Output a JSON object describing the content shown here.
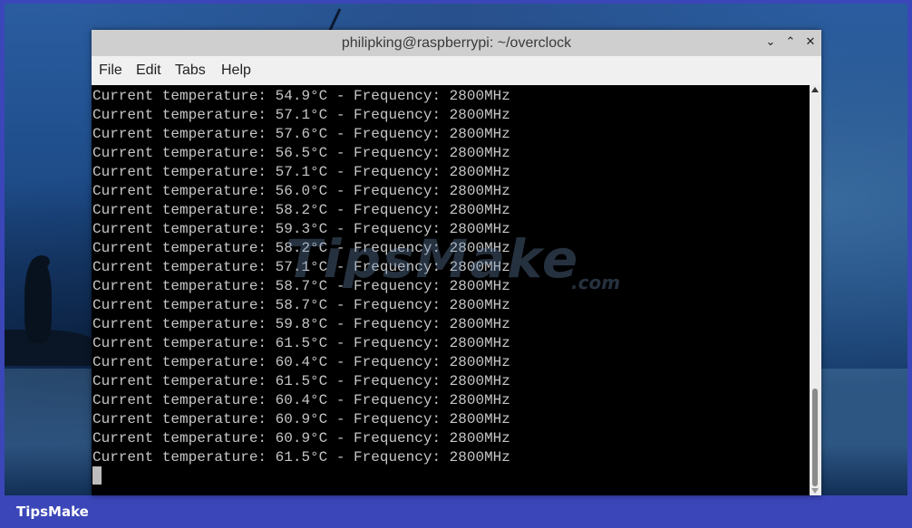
{
  "window": {
    "title": "philipking@raspberrypi: ~/overclock",
    "buttons": {
      "minimize": "⌄",
      "maximize": "⌃",
      "close": "✕"
    }
  },
  "menu": [
    "File",
    "Edit",
    "Tabs",
    "Help"
  ],
  "terminal": {
    "lines": [
      "Current temperature: 54.9°C - Frequency: 2800MHz",
      "Current temperature: 57.1°C - Frequency: 2800MHz",
      "Current temperature: 57.6°C - Frequency: 2800MHz",
      "Current temperature: 56.5°C - Frequency: 2800MHz",
      "Current temperature: 57.1°C - Frequency: 2800MHz",
      "Current temperature: 56.0°C - Frequency: 2800MHz",
      "Current temperature: 58.2°C - Frequency: 2800MHz",
      "Current temperature: 59.3°C - Frequency: 2800MHz",
      "Current temperature: 58.2°C - Frequency: 2800MHz",
      "Current temperature: 57.1°C - Frequency: 2800MHz",
      "Current temperature: 58.7°C - Frequency: 2800MHz",
      "Current temperature: 58.7°C - Frequency: 2800MHz",
      "Current temperature: 59.8°C - Frequency: 2800MHz",
      "Current temperature: 61.5°C - Frequency: 2800MHz",
      "Current temperature: 60.4°C - Frequency: 2800MHz",
      "Current temperature: 61.5°C - Frequency: 2800MHz",
      "Current temperature: 60.4°C - Frequency: 2800MHz",
      "Current temperature: 60.9°C - Frequency: 2800MHz",
      "Current temperature: 60.9°C - Frequency: 2800MHz",
      "Current temperature: 61.5°C - Frequency: 2800MHz"
    ]
  },
  "watermark": {
    "main": "TipsMake",
    "sub": ".com"
  },
  "footer": {
    "brand": "TipsMake"
  },
  "colors": {
    "frame": "#3b46b8",
    "terminal_bg": "#000000",
    "terminal_fg": "#c6c6c6",
    "titlebar": "#cfcfcf"
  }
}
